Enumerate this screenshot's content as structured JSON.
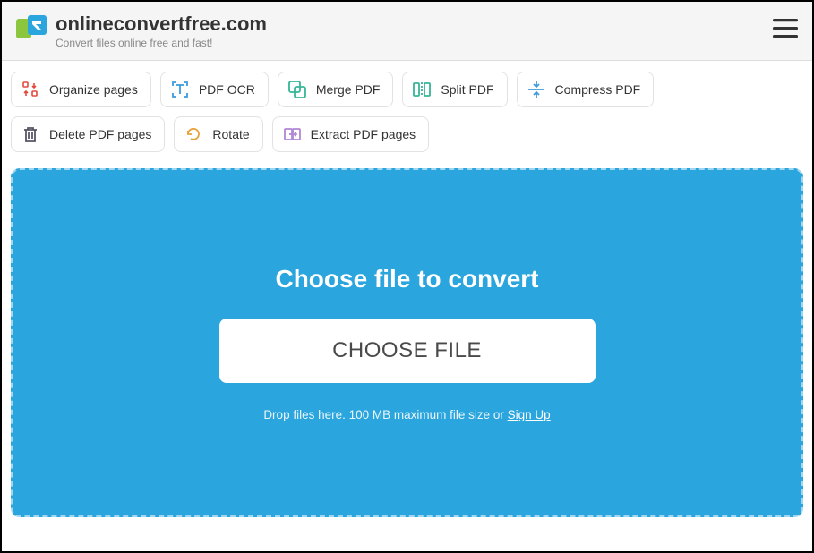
{
  "header": {
    "title": "onlineconvertfree.com",
    "tagline": "Convert files online free and fast!"
  },
  "tools": [
    {
      "id": "organize-pages",
      "label": "Organize pages"
    },
    {
      "id": "pdf-ocr",
      "label": "PDF OCR"
    },
    {
      "id": "merge-pdf",
      "label": "Merge PDF"
    },
    {
      "id": "split-pdf",
      "label": "Split PDF"
    },
    {
      "id": "compress-pdf",
      "label": "Compress PDF"
    },
    {
      "id": "delete-pages",
      "label": "Delete PDF pages"
    },
    {
      "id": "rotate",
      "label": "Rotate"
    },
    {
      "id": "extract-pages",
      "label": "Extract PDF pages"
    }
  ],
  "dropzone": {
    "title": "Choose file to convert",
    "button": "CHOOSE FILE",
    "hint_prefix": "Drop files here. 100 MB maximum file size or ",
    "signup": "Sign Up"
  },
  "colors": {
    "accent": "#2ba5de"
  }
}
